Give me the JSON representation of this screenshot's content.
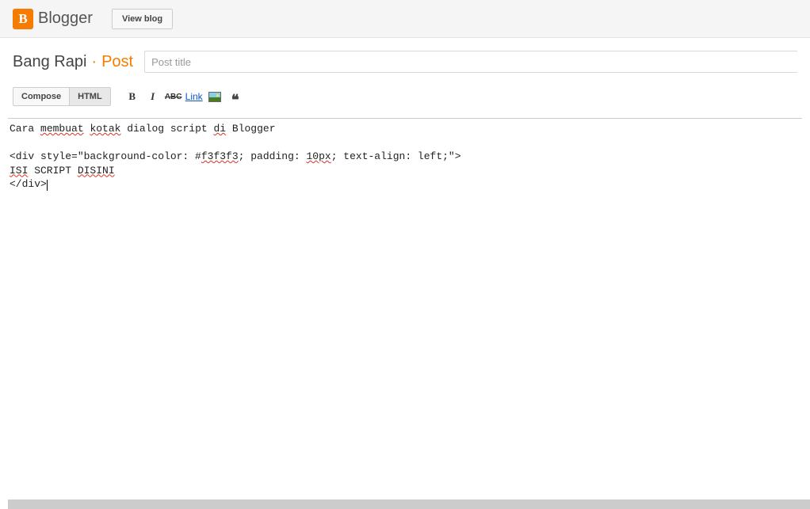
{
  "header": {
    "brand": "Blogger",
    "view_blog_label": "View blog"
  },
  "title_row": {
    "blog_name": "Bang Rapi",
    "separator": "·",
    "section_label": "Post",
    "title_placeholder": "Post title"
  },
  "toolbar": {
    "compose_label": "Compose",
    "html_label": "HTML",
    "link_label": "Link"
  },
  "editor": {
    "line1_p1": "Cara ",
    "line1_w1": "membuat",
    "line1_p2": " ",
    "line1_w2": "kotak",
    "line1_p3": " dialog script ",
    "line1_w3": "di",
    "line1_p4": " Blogger",
    "line3_p1": "<div style=\"background-color: #",
    "line3_w1": "f3f3f3",
    "line3_p2": "; padding: ",
    "line3_w2": "10px",
    "line3_p3": "; text-align: left;\">",
    "line4_w1": "ISI",
    "line4_p1": " SCRIPT ",
    "line4_w2": "DISINI",
    "line5": "</div>"
  }
}
